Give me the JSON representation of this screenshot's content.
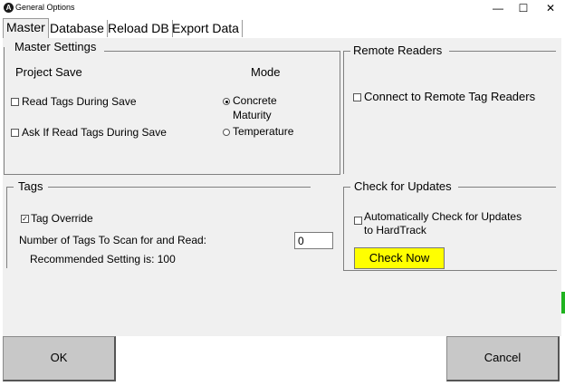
{
  "window": {
    "title": "General Options",
    "app_icon": "hardtrack-logo-icon",
    "controls": {
      "minimize": "—",
      "maximize": "☐",
      "close": "✕"
    }
  },
  "tabs": [
    {
      "label": "Master",
      "active": true
    },
    {
      "label": "Database",
      "active": false
    },
    {
      "label": "Reload DB",
      "active": false
    },
    {
      "label": "Export Data",
      "active": false
    }
  ],
  "master_settings": {
    "title": "Master Settings",
    "project_save_heading": "Project Save",
    "mode_heading": "Mode",
    "read_tags_during_save": {
      "label": "Read Tags During Save",
      "checked": false
    },
    "ask_read_tags_during_save": {
      "label": "Ask If Read Tags During Save",
      "checked": false
    },
    "mode_concrete_maturity": {
      "label_line1": "Concrete",
      "label_line2": "Maturity",
      "selected": true
    },
    "mode_temperature": {
      "label": "Temperature",
      "selected": false
    }
  },
  "remote_readers": {
    "title": "Remote Readers",
    "connect_remote": {
      "label": "Connect to Remote Tag Readers",
      "checked": false
    }
  },
  "tags": {
    "title": "Tags",
    "tag_override": {
      "label": "Tag Override",
      "checked": true,
      "mark": "✓"
    },
    "num_tags_label": "Number of Tags To Scan for and Read:",
    "num_tags_value": "0",
    "recommended_text": "Recommended Setting is: 100"
  },
  "updates": {
    "title": "Check for Updates",
    "auto_check": {
      "label_line1": "Automatically Check for Updates",
      "label_line2": "to HardTrack",
      "checked": false
    },
    "check_now_label": "Check Now",
    "check_now_color": "#ffff00"
  },
  "footer": {
    "ok_label": "OK",
    "cancel_label": "Cancel"
  }
}
